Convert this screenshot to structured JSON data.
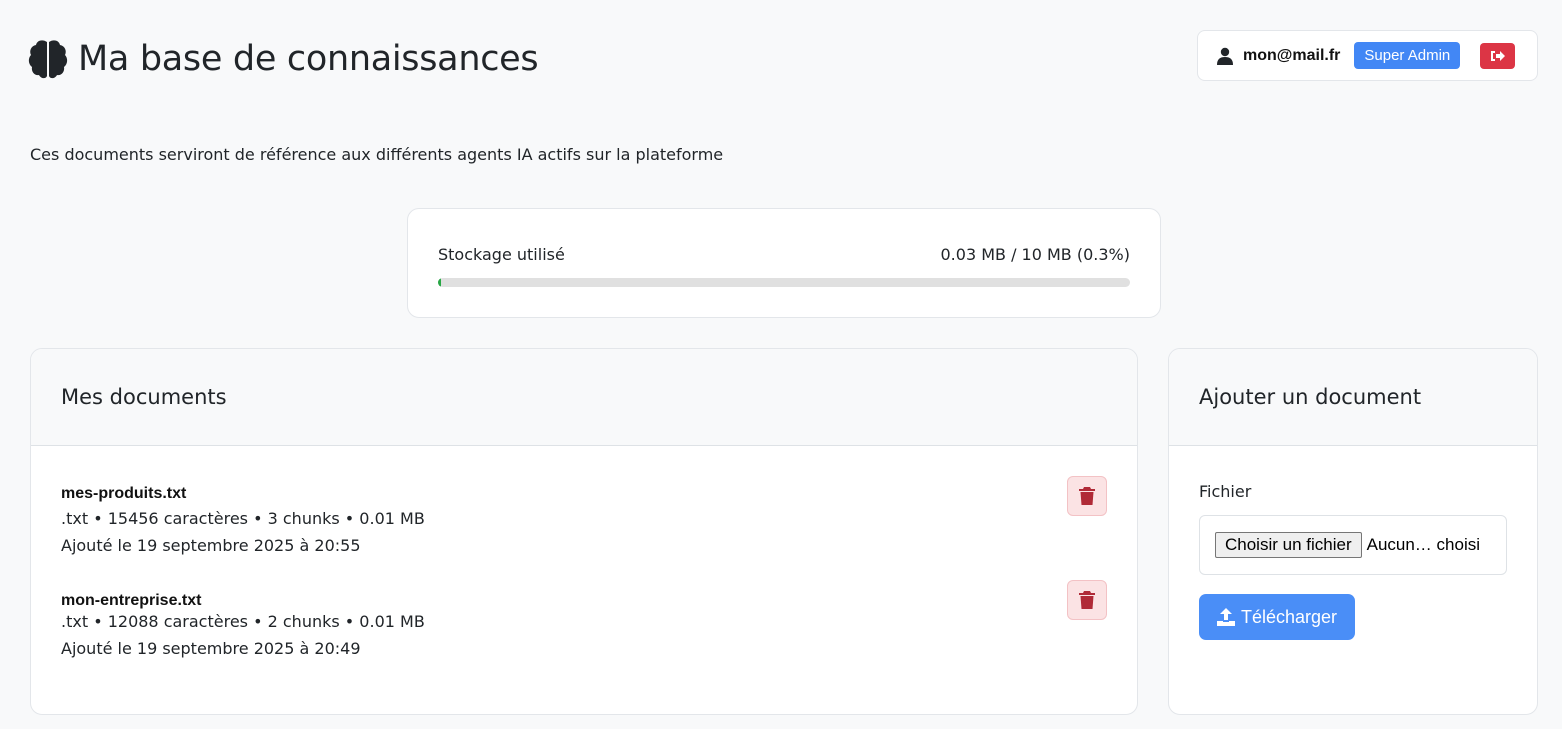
{
  "header": {
    "title": "Ma base de connaissances",
    "icon": "brain-icon"
  },
  "user": {
    "email": "mon@mail.fr",
    "role": "Super Admin",
    "icons": {
      "user": "user-icon",
      "logout": "sign-out-icon"
    }
  },
  "subtitle": "Ces documents serviront de référence aux différents agents IA actifs sur la plateforme",
  "storage": {
    "label": "Stockage utilisé",
    "value_text": "0.03 MB / 10 MB (0.3%)",
    "used_percent": 0.3
  },
  "documents": {
    "title": "Mes documents",
    "items": [
      {
        "name": "mes-produits.txt",
        "meta": ".txt • 15456 caractères • 3 chunks • 0.01 MB",
        "date": "Ajouté le 19 septembre 2025 à 20:55"
      },
      {
        "name": "mon-entreprise.txt",
        "meta": ".txt • 12088 caractères • 2 chunks • 0.01 MB",
        "date": "Ajouté le 19 septembre 2025 à 20:49"
      }
    ]
  },
  "add_document": {
    "title": "Ajouter un document",
    "field_label": "Fichier",
    "choose_button": "Choisir un fichier",
    "no_file_text": "Aucun… choisi",
    "upload_button": "Télécharger"
  },
  "colors": {
    "primary": "#4a8ef7",
    "danger": "#dc3545",
    "progress": "#28a745",
    "delete_icon": "#b02a37"
  }
}
